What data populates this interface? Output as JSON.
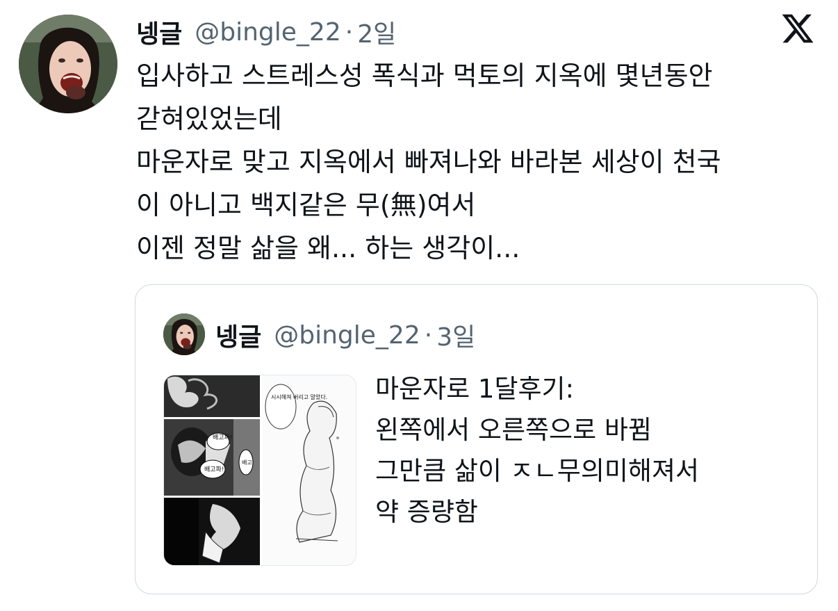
{
  "tweet": {
    "author_name": "넹글",
    "author_handle": "@bingle_22",
    "separator": "·",
    "time": "2일",
    "avatar_icon": "profile-photo",
    "lines": [
      "입사하고 스트레스성 폭식과 먹토의 지옥에 몇년동안",
      "갇혀있었는데",
      "마운자로 맞고 지옥에서 빠져나와 바라본 세상이 천국",
      "이 아니고 백지같은 무(無)여서",
      "이젠 정말 삶을 왜... 하는 생각이..."
    ]
  },
  "quoted_tweet": {
    "author_name": "넹글",
    "author_handle": "@bingle_22",
    "separator": "·",
    "time": "3일",
    "avatar_icon": "profile-photo",
    "media_icon": "manga-comparison-image",
    "media_text": {
      "bubble_right": "시시해져 버리고 말았다.",
      "bubble_left_1": "배고파!",
      "bubble_left_2": "배고파!",
      "bubble_left_3": "배고"
    },
    "lines": [
      "마운자로 1달후기:",
      "왼쪽에서 오른쪽으로 바뀜",
      "그만큼 삶이 ㅈㄴ무의미해져서",
      "약 증량함"
    ]
  },
  "brand": {
    "logo_icon": "x-logo-icon",
    "text_color": "#0f1419",
    "muted_color": "#536471",
    "border_color": "#cfd9de"
  }
}
